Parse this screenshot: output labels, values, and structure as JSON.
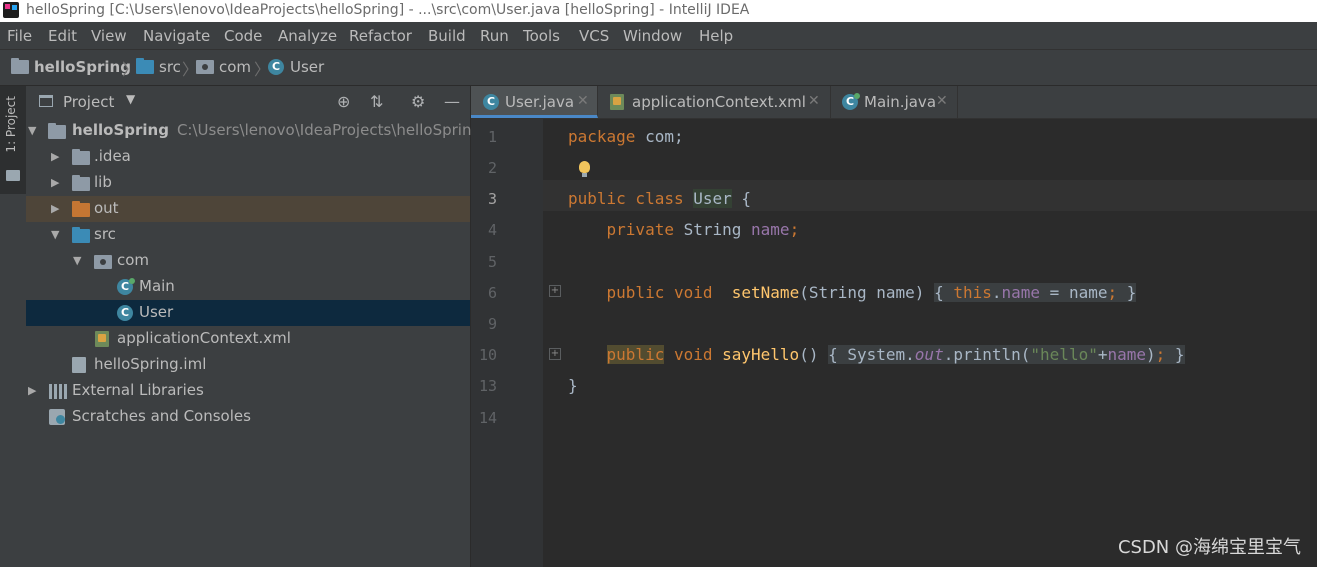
{
  "window": {
    "title": "helloSpring [C:\\Users\\lenovo\\IdeaProjects\\helloSpring] - ...\\src\\com\\User.java [helloSpring] - IntelliJ IDEA"
  },
  "menu": [
    "File",
    "Edit",
    "View",
    "Navigate",
    "Code",
    "Analyze",
    "Refactor",
    "Build",
    "Run",
    "Tools",
    "VCS",
    "Window",
    "Help"
  ],
  "breadcrumb": [
    "helloSpring",
    "src",
    "com",
    "User"
  ],
  "left_strip": {
    "label": "1: Project"
  },
  "project_panel": {
    "title": "Project",
    "tree": [
      {
        "label": "helloSpring",
        "path": "C:\\Users\\lenovo\\IdeaProjects\\helloSpring"
      },
      {
        "label": ".idea"
      },
      {
        "label": "lib"
      },
      {
        "label": "out"
      },
      {
        "label": "src"
      },
      {
        "label": "com"
      },
      {
        "label": "Main"
      },
      {
        "label": "User"
      },
      {
        "label": "applicationContext.xml"
      },
      {
        "label": "helloSpring.iml"
      },
      {
        "label": "External Libraries"
      },
      {
        "label": "Scratches and Consoles"
      }
    ]
  },
  "editor_tabs": [
    "User.java",
    "applicationContext.xml",
    "Main.java"
  ],
  "editor": {
    "line_numbers": [
      "1",
      "2",
      "3",
      "4",
      "5",
      "6",
      "9",
      "10",
      "13",
      "14"
    ],
    "code": {
      "l1": {
        "kw": "package",
        "rest": " com;"
      },
      "l3": {
        "kw1": "public",
        "kw2": " class ",
        "cls": "User",
        "rest": " {"
      },
      "l4": {
        "kw": "private",
        "type": " String ",
        "fld": "name",
        "semi": ";"
      },
      "l6": {
        "kw1": "public",
        "kw2": " void ",
        "fn": "setName",
        "params": "(String name)",
        "sp": " ",
        "lb": "{ ",
        "this": "this",
        "dot": ".",
        "fld": "name",
        "eq": " = name",
        "semi": ";",
        "rb": " }"
      },
      "l10": {
        "kw1": "public",
        "kw2": " void ",
        "fn": "sayHello",
        "params": "()",
        "sp": " ",
        "lb": "{ ",
        "sys": "System.",
        "out": "out",
        "call": ".println(",
        "str": "\"hello\"",
        "plus": "+",
        "fld": "name",
        "close": ")",
        "semi": ";",
        "rb": " }"
      },
      "l13": {
        "text": "}"
      }
    }
  },
  "watermark": "CSDN @海绵宝里宝气"
}
